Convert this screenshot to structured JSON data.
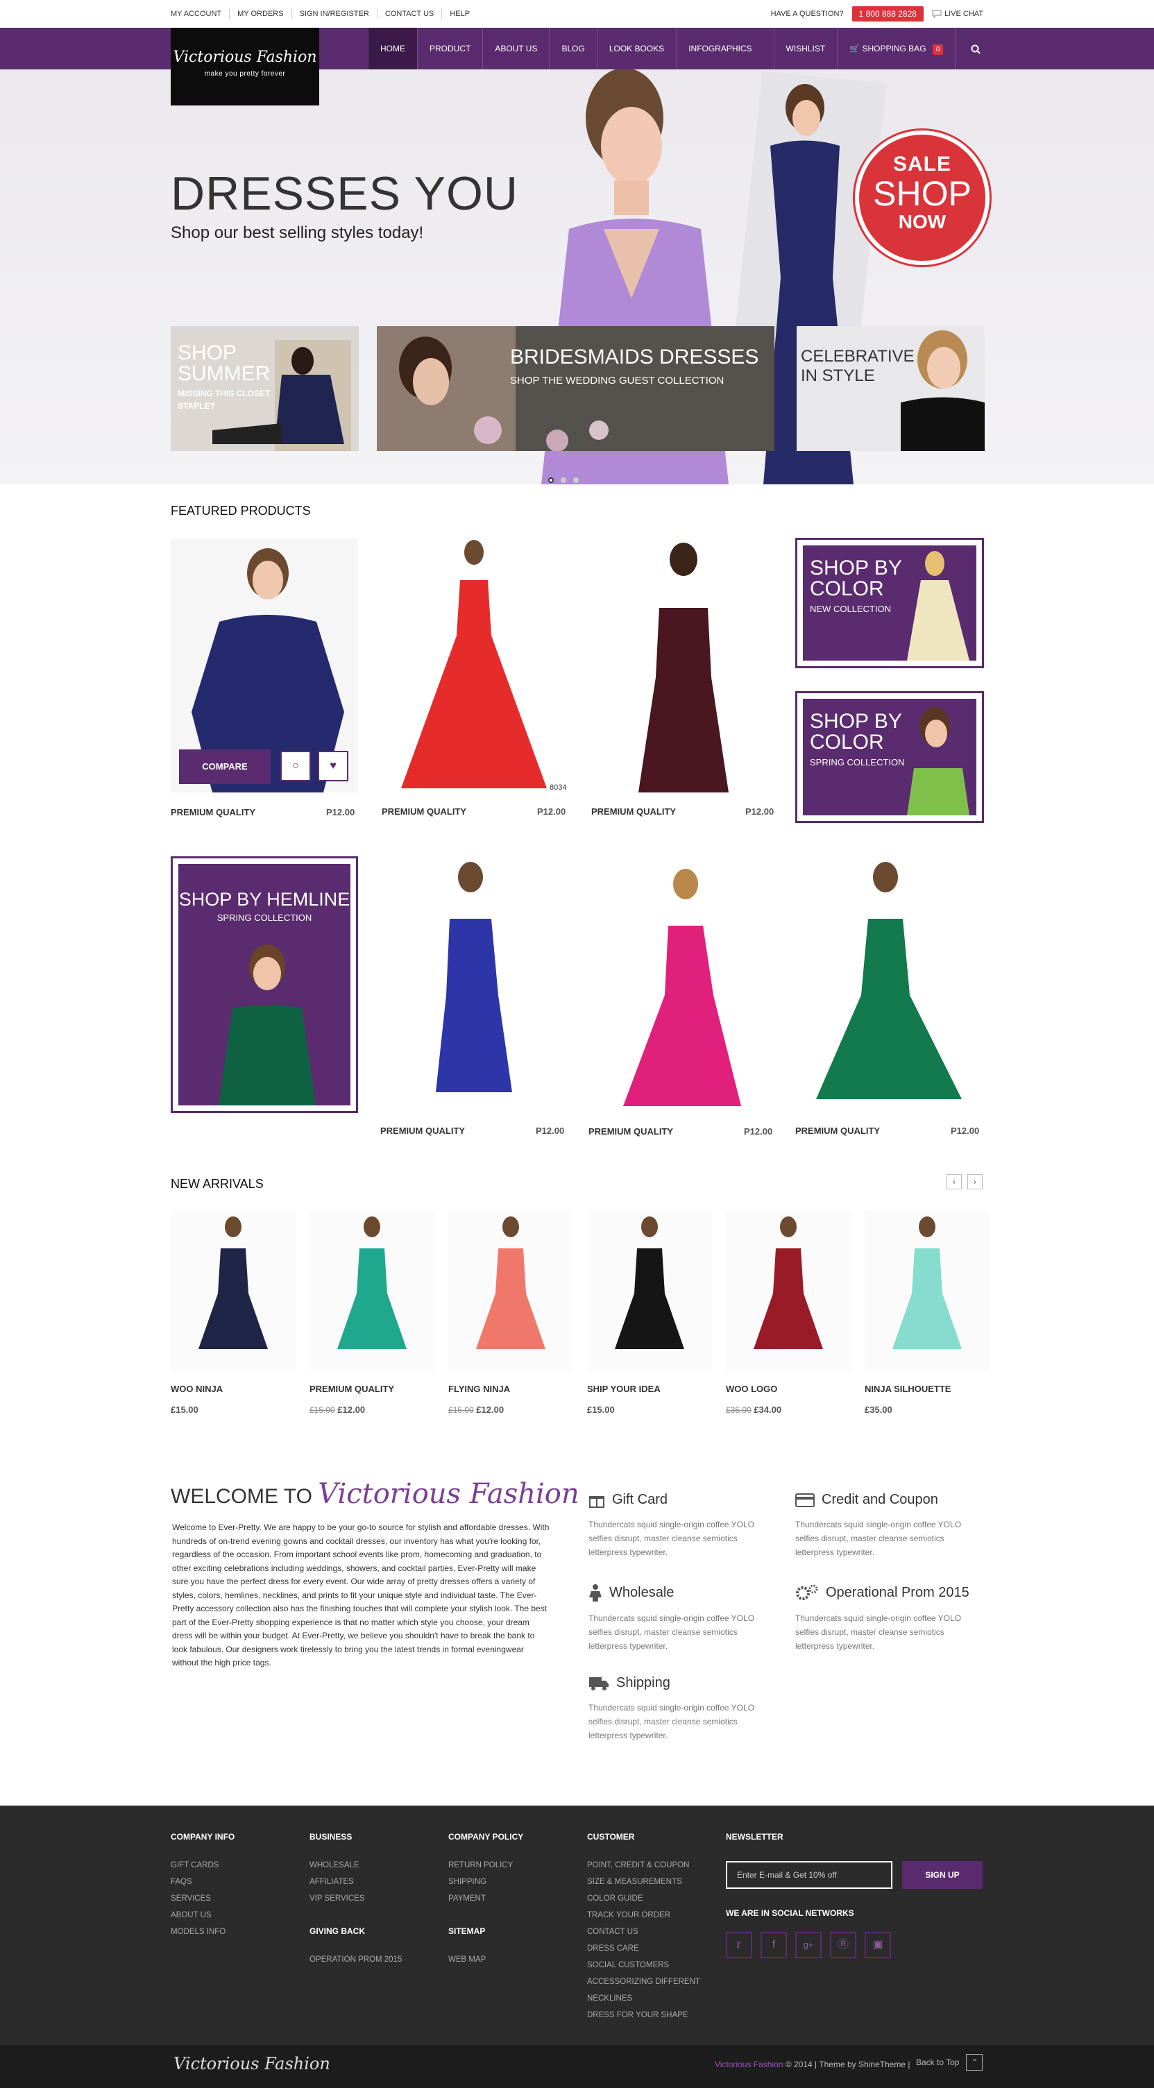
{
  "topbar": {
    "links": [
      "MY ACCOUNT",
      "MY ORDERS",
      "SIGN IN/REGISTER",
      "CONTACT US",
      "HELP"
    ],
    "question": "HAVE A QUESTION?",
    "phone": "1 800 888 2828",
    "live_chat": "LIVE CHAT"
  },
  "logo": {
    "name": "Victorious Fashion",
    "tagline": "make you pretty forever"
  },
  "nav": {
    "items": [
      "HOME",
      "PRODUCT",
      "ABOUT US",
      "BLOG",
      "LOOK BOOKS",
      "INFOGRAPHICS"
    ],
    "wishlist": "WISHLIST",
    "bag": "SHOPPING BAG",
    "bag_count": "0",
    "search_icon": "search-icon"
  },
  "hero": {
    "title": "DRESSES YOU",
    "subtitle": "Shop our best selling styles today!",
    "sale": {
      "l1": "SALE",
      "l2": "SHOP",
      "l3": "NOW"
    },
    "promos": [
      {
        "title1": "SHOP",
        "title2": "SUMMER",
        "sub1": "MISSING THIS CLOSET",
        "sub2": "STAPLE?"
      },
      {
        "title": "BRIDESMAIDS DRESSES",
        "sub": "SHOP THE WEDDING GUEST COLLECTION"
      },
      {
        "title1": "CELEBRATIVE",
        "title2": "IN STYLE"
      }
    ]
  },
  "featured": {
    "heading": "FEATURED PRODUCTS",
    "compare": "COMPARE",
    "products": [
      {
        "name": "PREMIUM QUALITY",
        "price": "P12.00"
      },
      {
        "name": "PREMIUM QUALITY",
        "price": "P12.00",
        "tag": "8034"
      },
      {
        "name": "PREMIUM QUALITY",
        "price": "P12.00"
      },
      {
        "name": "PREMIUM QUALITY",
        "price": "P12.00"
      },
      {
        "name": "PREMIUM QUALITY",
        "price": "P12.00"
      },
      {
        "name": "PREMIUM QUALITY",
        "price": "P12.00"
      }
    ],
    "cats": [
      {
        "t1": "SHOP BY",
        "t2": "COLOR",
        "sub": "NEW COLLECTION"
      },
      {
        "t1": "SHOP BY",
        "t2": "COLOR",
        "sub": "SPRING COLLECTION"
      },
      {
        "t1": "SHOP BY HEMLINE",
        "sub": "SPRING COLLECTION"
      }
    ]
  },
  "arrivals": {
    "heading": "NEW ARRIVALS",
    "items": [
      {
        "name": "WOO NINJA",
        "old": "",
        "price": "£15.00",
        "color": "#1f2547"
      },
      {
        "name": "PREMIUM QUALITY",
        "old": "£15.00",
        "price": "£12.00",
        "color": "#1fa88e"
      },
      {
        "name": "FLYING NINJA",
        "old": "£15.00",
        "price": "£12.00",
        "color": "#f0786a"
      },
      {
        "name": "SHIP YOUR IDEA",
        "old": "",
        "price": "£15.00",
        "color": "#151515"
      },
      {
        "name": "WOO LOGO",
        "old": "£35.00",
        "price": "£34.00",
        "color": "#9a1b28"
      },
      {
        "name": "NINJA SILHOUETTE",
        "old": "",
        "price": "£35.00",
        "color": "#86dccf"
      }
    ]
  },
  "welcome": {
    "prefix": "WELCOME TO",
    "brand": "Victorious Fashion",
    "text": "Welcome to Ever-Pretty. We are happy to be your go-to source for stylish and affordable dresses. With hundreds of on-trend evening gowns and cocktail dresses, our inventory has what you're looking for, regardless of the occasion. From important school events like prom, homecoming and graduation, to other exciting celebrations including weddings, showers, and cocktail parties, Ever-Pretty will make sure you have the perfect dress for every event. Our wide array of pretty dresses offers a variety of styles, colors, hemlines, necklines, and prints to fit your unique style and individual taste. The Ever-Pretty accessory collection also has the finishing touches that will complete your stylish look. The best part of the Ever-Pretty shopping experience is that no matter which style you choose, your dream dress will be within your budget. At Ever-Pretty, we believe you shouldn't have to break the bank to look fabulous. Our designers work tirelessly to bring you the latest trends in formal eveningwear without the high price tags."
  },
  "features": [
    {
      "icon": "gift-icon",
      "title": "Gift Card",
      "desc": "Thundercats squid single-origin coffee YOLO selfies disrupt, master cleanse semiotics letterpress typewriter."
    },
    {
      "icon": "credit-card-icon",
      "title": "Credit and Coupon",
      "desc": "Thundercats squid single-origin coffee YOLO selfies disrupt, master cleanse semiotics letterpress typewriter."
    },
    {
      "icon": "person-icon",
      "title": "Wholesale",
      "desc": "Thundercats squid single-origin coffee YOLO selfies disrupt, master cleanse semiotics letterpress typewriter."
    },
    {
      "icon": "gears-icon",
      "title": "Operational Prom 2015",
      "desc": "Thundercats squid single-origin coffee YOLO selfies disrupt, master cleanse semiotics letterpress typewriter."
    },
    {
      "icon": "truck-icon",
      "title": "Shipping",
      "desc": "Thundercats squid single-origin coffee YOLO selfies disrupt, master cleanse semiotics letterpress typewriter."
    }
  ],
  "footer": {
    "company_info": {
      "title": "COMPANY INFO",
      "links": [
        "GIFT CARDS",
        "FAQS",
        "SERVICES",
        "ABOUT US",
        "MODELS INFO"
      ]
    },
    "business": {
      "title": "BUSINESS",
      "links": [
        "WHOLESALE",
        "AFFILIATES",
        "VIP SERVICES"
      ]
    },
    "giving_back": {
      "title": "GIVING BACK",
      "links": [
        "OPERATION PROM 2015"
      ]
    },
    "company_policy": {
      "title": "COMPANY POLICY",
      "links": [
        "RETURN POLICY",
        "SHIPPING",
        "PAYMENT"
      ]
    },
    "sitemap": {
      "title": "SITEMAP",
      "links": [
        "WEB MAP"
      ]
    },
    "customer": {
      "title": "CUSTOMER",
      "links": [
        "POINT, CREDIT & COUPON",
        "SIZE & MEASUREMENTS",
        "COLOR GUIDE",
        "TRACK YOUR ORDER",
        "CONTACT US",
        "DRESS CARE",
        "SOCIAL CUSTOMERS",
        "ACCESSORIZING DIFFERENT",
        "NECKLINES",
        "DRESS FOR YOUR SHAPE"
      ]
    },
    "newsletter": {
      "title": "NEWSLETTER",
      "placeholder": "Enter E-mail & Get 10% off",
      "button": "SIGN UP"
    },
    "social_title": "WE ARE IN SOCIAL NETWORKS",
    "social_icons": [
      "twitter-icon",
      "facebook-icon",
      "google-plus-icon",
      "pinterest-icon",
      "instagram-icon"
    ]
  },
  "bottom": {
    "logo": "Victorious Fashion",
    "brand": "Victorious Fashion",
    "copyright": "© 2014 | Theme by ShineTheme |",
    "back_to_top": "Back to Top"
  },
  "colors": {
    "purple": "#5a2b6e",
    "red": "#d9343a",
    "footer": "#2b2b2b"
  }
}
